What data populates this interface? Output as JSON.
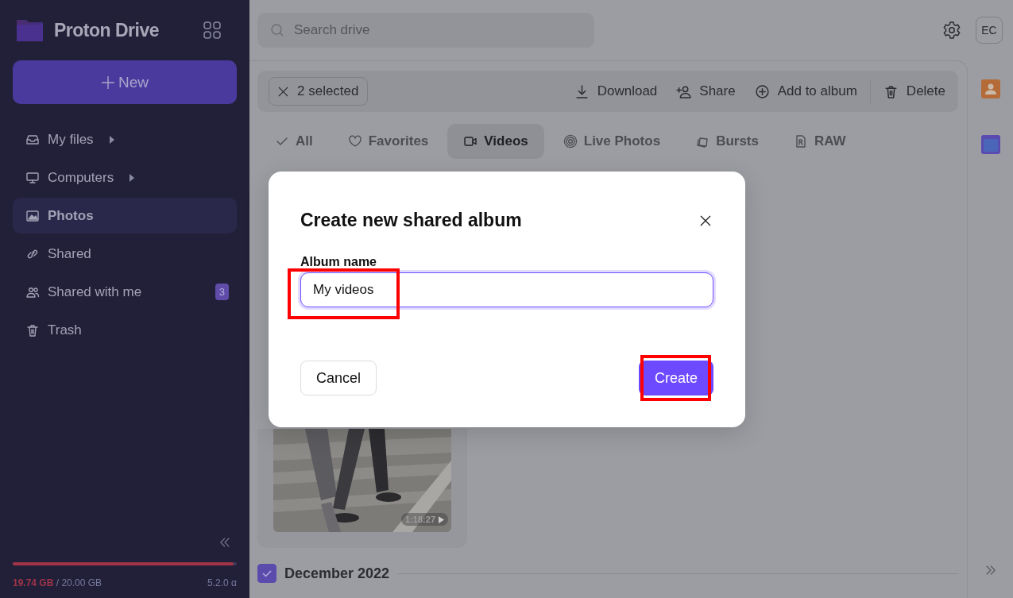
{
  "brand": {
    "name": "Proton Drive"
  },
  "new_button": {
    "label": "New"
  },
  "sidebar": {
    "items": [
      {
        "label": "My files",
        "selected": false,
        "expandable": true
      },
      {
        "label": "Computers",
        "selected": false,
        "expandable": true
      },
      {
        "label": "Photos",
        "selected": true,
        "expandable": false
      },
      {
        "label": "Shared",
        "selected": false,
        "expandable": false
      },
      {
        "label": "Shared with me",
        "selected": false,
        "expandable": false,
        "badge": "3"
      },
      {
        "label": "Trash",
        "selected": false,
        "expandable": false
      }
    ]
  },
  "storage": {
    "used": "19.74 GB",
    "total": "/ 20.00 GB",
    "level": 0.987,
    "version": "5.2.0 α"
  },
  "search": {
    "placeholder": "Search drive"
  },
  "account": {
    "initials": "EC"
  },
  "selection": {
    "label": "2 selected"
  },
  "actions": [
    {
      "label": "Download"
    },
    {
      "label": "Share"
    },
    {
      "label": "Add to album"
    },
    {
      "label": "Delete"
    }
  ],
  "filters": [
    {
      "label": "All",
      "selected": false
    },
    {
      "label": "Favorites",
      "selected": false
    },
    {
      "label": "Videos",
      "selected": true
    },
    {
      "label": "Live Photos",
      "selected": false
    },
    {
      "label": "Bursts",
      "selected": false
    },
    {
      "label": "RAW",
      "selected": false
    }
  ],
  "video_card": {
    "kind": "picture",
    "duration": "1:18:27"
  },
  "section": {
    "title": "December 2022",
    "checked": true
  },
  "dialog": {
    "title": "Create new shared album",
    "field_label": "Album name",
    "value": "My videos",
    "buttons": [
      {
        "label": "Cancel",
        "kind": "secondary"
      },
      {
        "label": "Create",
        "kind": "primary"
      }
    ]
  }
}
